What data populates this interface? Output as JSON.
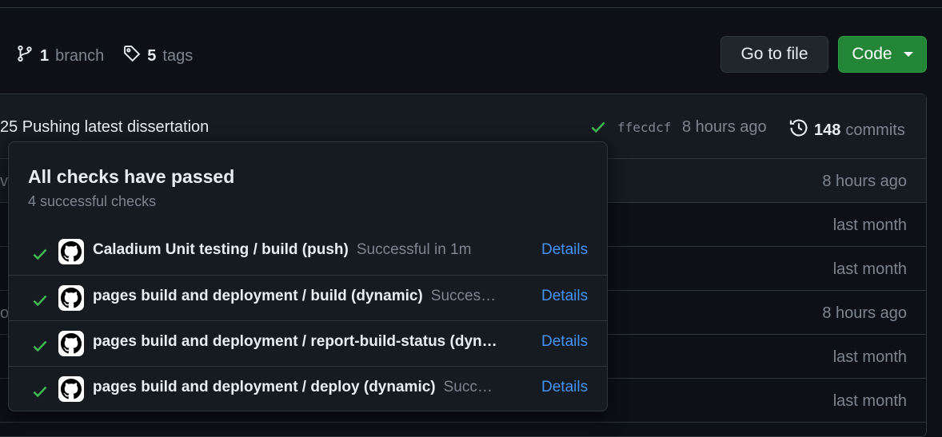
{
  "repo_meta": {
    "branch_count": "1",
    "branch_label": "branch",
    "tag_count": "5",
    "tag_label": "tags"
  },
  "buttons": {
    "go_to_file": "Go to file",
    "code": "Code"
  },
  "latest_commit": {
    "message": "25 Pushing latest dissertation",
    "sha": "ffecdcf",
    "time": "8 hours ago",
    "commit_count": "148",
    "commit_label": "commits"
  },
  "file_rows": [
    {
      "lead": "ve",
      "time": "8 hours ago"
    },
    {
      "lead": "",
      "time": "last month"
    },
    {
      "lead": "",
      "time": "last month"
    },
    {
      "lead": "o",
      "time": "8 hours ago"
    },
    {
      "lead": "",
      "time": "last month"
    },
    {
      "lead": "",
      "time": "last month"
    }
  ],
  "checks_popup": {
    "title": "All checks have passed",
    "subtitle": "4 successful checks",
    "checks": [
      {
        "name": "Caladium Unit testing / build (push)",
        "status": "Successful in 1m",
        "details": "Details"
      },
      {
        "name": "pages build and deployment / build (dynamic)",
        "status": "Succes…",
        "details": "Details"
      },
      {
        "name": "pages build and deployment / report-build-status (dyn…",
        "status": "",
        "details": "Details"
      },
      {
        "name": "pages build and deployment / deploy (dynamic)",
        "status": "Succ…",
        "details": "Details"
      }
    ]
  },
  "colors": {
    "background": "#0d1117",
    "surface": "#161b22",
    "border": "#30363d",
    "success": "#3fb950",
    "link": "#4493f8",
    "code_button": "#238636"
  },
  "icons": [
    "git-branch-icon",
    "tag-icon",
    "check-icon",
    "history-icon",
    "github-logo-icon",
    "caret-down-icon"
  ]
}
